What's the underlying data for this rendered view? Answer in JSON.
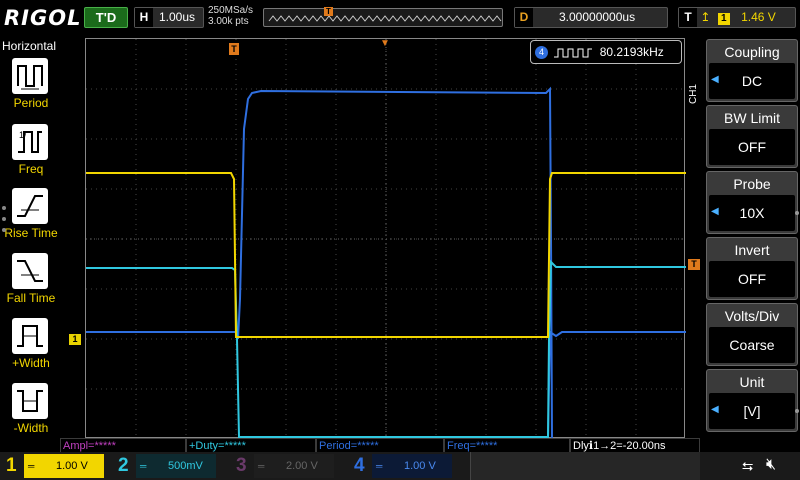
{
  "brand": "RIGOL",
  "run_status": "T'D",
  "horizontal": {
    "letter": "H",
    "timebase": "1.00us",
    "sample_rate": "250MSa/s",
    "memory": "3.00k pts"
  },
  "delay": {
    "letter": "D",
    "value": "3.00000000us"
  },
  "trigger": {
    "letter": "T",
    "source": "1",
    "level": "1.46 V",
    "marker": "T"
  },
  "left_panel": {
    "title": "Horizontal",
    "items": [
      {
        "label": "Period"
      },
      {
        "label": "Freq"
      },
      {
        "label": "Rise Time"
      },
      {
        "label": "Fall Time"
      },
      {
        "label": "+Width"
      },
      {
        "label": "-Width"
      }
    ]
  },
  "freq_counter": {
    "channel": "4",
    "value": "80.2193kHz"
  },
  "ch1_marker": "1",
  "measurements": [
    {
      "text": "Ampl=*****",
      "color": "#c040c0"
    },
    {
      "text": "+Duty=*****",
      "color": "#30c8e0"
    },
    {
      "text": "Period=*****",
      "color": "#2f6fe0"
    },
    {
      "text": "Freq=*****",
      "color": "#2f6fe0"
    },
    {
      "text": "Dlyℹ1→2=-20.00ns",
      "color": "#ffffff"
    }
  ],
  "right_menu": {
    "channel": "CH1",
    "items": [
      {
        "title": "Coupling",
        "value": "DC"
      },
      {
        "title": "BW Limit",
        "value": "OFF"
      },
      {
        "title": "Probe",
        "value": "10X"
      },
      {
        "title": "Invert",
        "value": "OFF"
      },
      {
        "title": "Volts/Div",
        "value": "Coarse"
      },
      {
        "title": "Unit",
        "value": "[V]"
      }
    ]
  },
  "channels": [
    {
      "num": "1",
      "scale": "1.00 V",
      "color": "#f2d600",
      "active": true
    },
    {
      "num": "2",
      "scale": "500mV",
      "color": "#30c8e0",
      "active": false
    },
    {
      "num": "3",
      "scale": "2.00 V",
      "color": "#b040b0",
      "active": false
    },
    {
      "num": "4",
      "scale": "1.00 V",
      "color": "#2f6fe0",
      "active": false
    }
  ],
  "colors": {
    "ch1": "#f2d600",
    "ch2": "#30c8e0",
    "ch3": "#b040b0",
    "ch4": "#2f6fe0",
    "trigger": "#e07a1c"
  }
}
